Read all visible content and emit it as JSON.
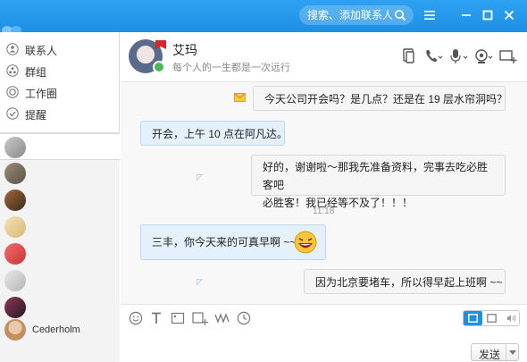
{
  "titlebar": {
    "search_placeholder": "搜索、添加联系人"
  },
  "sidebar": {
    "nav": [
      {
        "label": "联系人",
        "icon": "contacts-icon"
      },
      {
        "label": "群组",
        "icon": "group-icon"
      },
      {
        "label": "工作圈",
        "icon": "work-circle-icon"
      },
      {
        "label": "提醒",
        "icon": "reminder-icon"
      }
    ],
    "contacts": [
      {
        "name": ""
      },
      {
        "name": ""
      },
      {
        "name": ""
      },
      {
        "name": ""
      },
      {
        "name": ""
      },
      {
        "name": ""
      },
      {
        "name": ""
      },
      {
        "name": "Cederholm"
      }
    ]
  },
  "header": {
    "name": "艾玛",
    "signature": "每个人的一生都是一次远行"
  },
  "messages": [
    {
      "dir": "out",
      "text": "今天公司开会吗？是几点？还是在 19 层水帘洞吗？"
    },
    {
      "dir": "in",
      "text": "开会，上午 10 点在阿凡达。"
    },
    {
      "dir": "out",
      "text": "好的，谢谢啦～那我先准备资料，完事去吃必胜客吧"
    },
    {
      "dir": "out",
      "text": "必胜客！我已经等不及了！！！"
    },
    {
      "dir": "time",
      "text": "11:18"
    },
    {
      "dir": "in",
      "text": "三丰，你今天来的可真早啊 ~~"
    },
    {
      "dir": "out",
      "text": "因为北京要堵车，所以得早起上班啊 ~~"
    }
  ],
  "input": {
    "send_label": "发送"
  },
  "colors": {
    "accent": "#1d90e6",
    "incoming_bubble": "#e4f1fd",
    "outgoing_bubble": "#f5f5f5",
    "online": "#4cb850"
  }
}
